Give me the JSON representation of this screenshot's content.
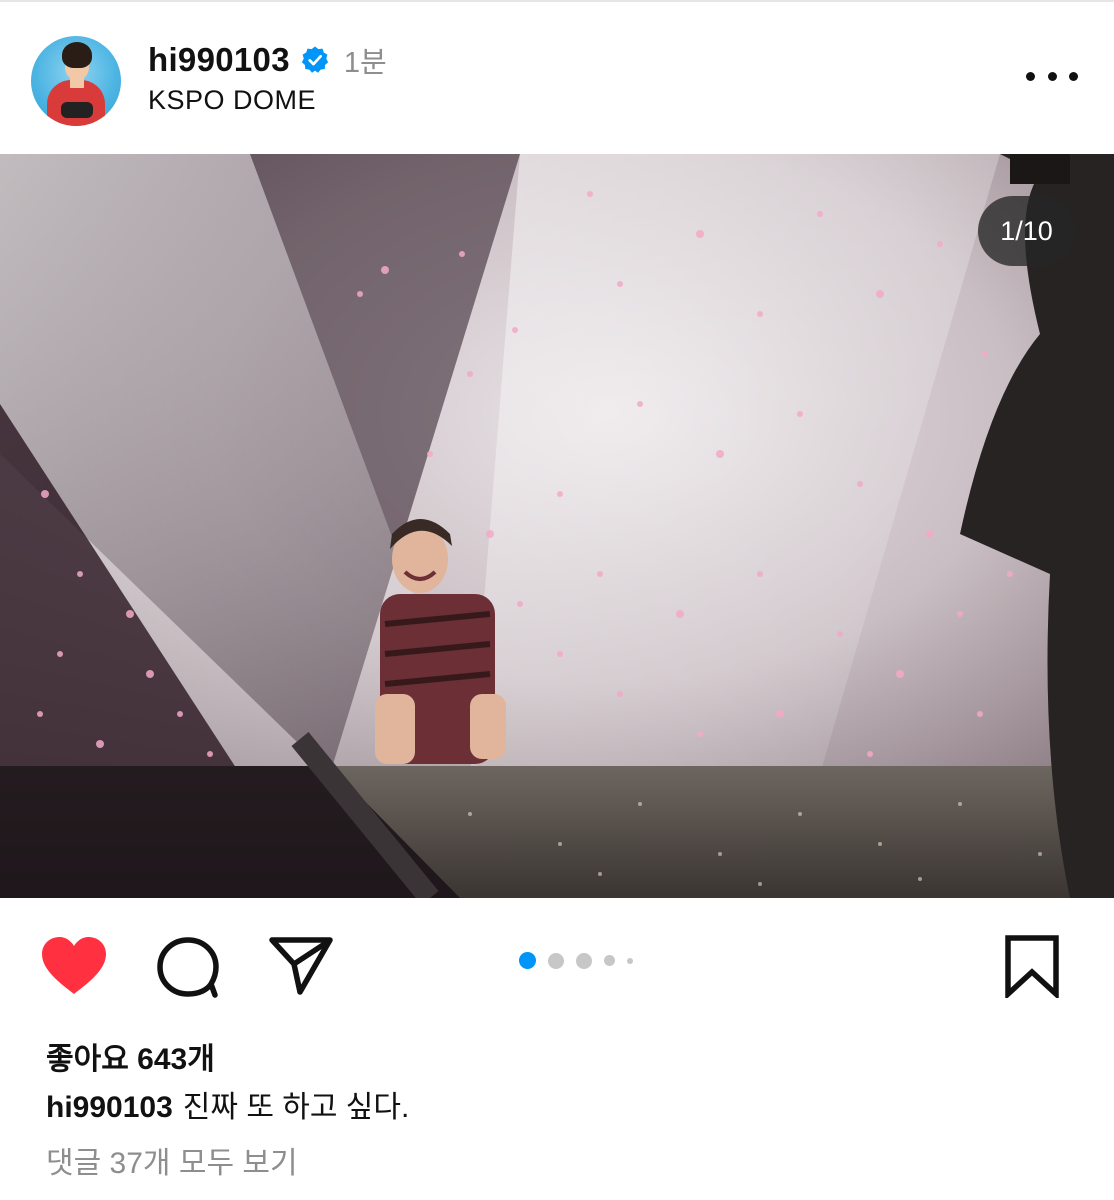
{
  "header": {
    "username": "hi990103",
    "time": "1분",
    "location": "KSPO DOME"
  },
  "post": {
    "image_counter": "1/10",
    "carousel": {
      "total_dots_visible": 5,
      "active_index": 0
    },
    "likes": "좋아요 643개",
    "caption_user": "hi990103",
    "caption_text": "진짜 또 하고 싶다.",
    "comments_link": "댓글 37개 모두 보기"
  },
  "icons": {
    "like": "heart-icon-filled",
    "comment": "comment-bubble-icon",
    "share": "paper-plane-icon",
    "save": "bookmark-icon",
    "more": "more-options-icon",
    "verified": "verified-badge-icon"
  },
  "colors": {
    "like_red": "#ff3040",
    "verified_blue": "#0095f6",
    "active_dot": "#0095f6",
    "muted_text": "#8e8e8e"
  }
}
